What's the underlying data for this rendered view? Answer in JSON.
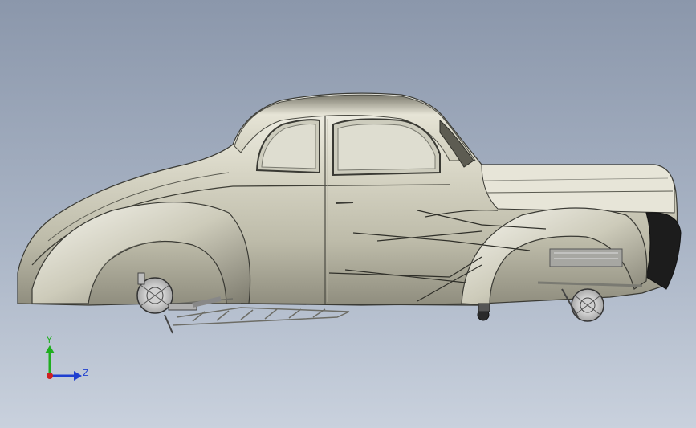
{
  "viewport": {
    "background_top": "#8b97ab",
    "background_bottom": "#c9d1dd",
    "model": {
      "subject": "car-body-side-view",
      "body_color": "#d8d6c6",
      "wheel_hub_color": "#e9e9e9"
    }
  },
  "triad": {
    "y_label": "Y",
    "z_label": "Z",
    "y_color": "#1fae1f",
    "z_color": "#1f3fd0",
    "origin_color": "#d02020"
  }
}
